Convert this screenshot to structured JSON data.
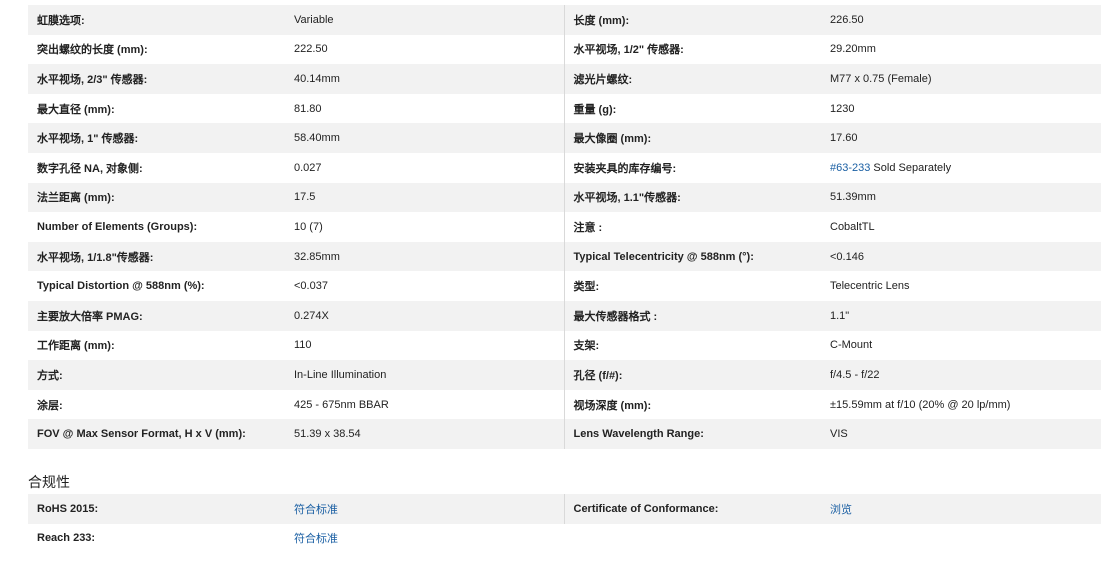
{
  "specs": [
    {
      "l1": "虹膜选项:",
      "v1": "Variable",
      "l2": "长度 (mm):",
      "v2": "226.50"
    },
    {
      "l1": "突出螺纹的长度 (mm):",
      "v1": "222.50",
      "l2": "水平视场, 1/2\" 传感器:",
      "v2": "29.20mm"
    },
    {
      "l1": "水平视场, 2/3\" 传感器:",
      "v1": "40.14mm",
      "l2": "滤光片螺纹:",
      "v2": "M77 x 0.75 (Female)"
    },
    {
      "l1": "最大直径 (mm):",
      "v1": "81.80",
      "l2": "重量 (g):",
      "v2": "1230"
    },
    {
      "l1": "水平视场, 1\" 传感器:",
      "v1": "58.40mm",
      "l2": "最大像圈 (mm):",
      "v2": "17.60"
    },
    {
      "l1": "数字孔径 NA, 对象侧:",
      "v1": "0.027",
      "l2": "安装夹具的库存编号:",
      "v2_link": "#63-233",
      "v2": " Sold Separately"
    },
    {
      "l1": "法兰距离 (mm):",
      "v1": "17.5",
      "l2": "水平视场, 1.1\"传感器:",
      "v2": "51.39mm"
    },
    {
      "l1": "Number of Elements (Groups):",
      "v1": "10 (7)",
      "l2": "注意 :",
      "v2": "CobaltTL"
    },
    {
      "l1": "水平视场, 1/1.8\"传感器:",
      "v1": "32.85mm",
      "l2": "Typical Telecentricity @ 588nm (°):",
      "v2": "<0.146"
    },
    {
      "l1": "Typical Distortion @ 588nm (%):",
      "v1": "<0.037",
      "l2": "类型:",
      "v2": "Telecentric Lens"
    },
    {
      "l1": "主要放大倍率 PMAG:",
      "v1": "0.274X",
      "l2": "最大传感器格式 :",
      "v2": "1.1\""
    },
    {
      "l1": "工作距离 (mm):",
      "v1": "110",
      "l2": "支架:",
      "v2": "C-Mount"
    },
    {
      "l1": "方式:",
      "v1": "In-Line Illumination",
      "l2": "孔径 (f/#):",
      "v2": "f/4.5 - f/22"
    },
    {
      "l1": "涂层:",
      "v1": "425 - 675nm BBAR",
      "l2": "视场深度 (mm):",
      "v2": "±15.59mm at f/10 (20% @ 20 lp/mm)"
    },
    {
      "l1": "FOV @ Max Sensor Format, H x V (mm):",
      "v1": "51.39 x 38.54",
      "l2": "Lens Wavelength Range:",
      "v2": "VIS"
    }
  ],
  "compliance": {
    "title": "合规性",
    "rows": [
      {
        "l1": "RoHS 2015:",
        "v1": "符合标准",
        "l2": "Certificate of Conformance:",
        "v2": "浏览"
      },
      {
        "l1": "Reach 233:",
        "v1": "符合标准",
        "l2": "",
        "v2": ""
      }
    ]
  }
}
